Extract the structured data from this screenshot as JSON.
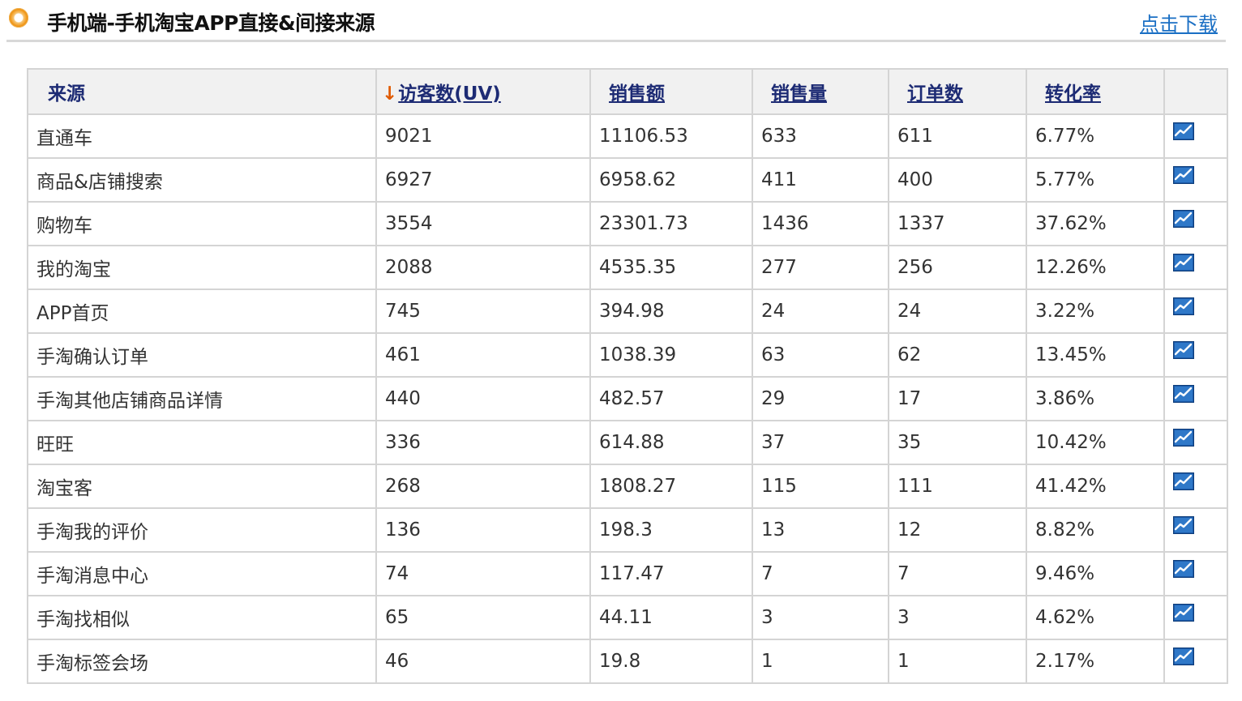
{
  "header": {
    "title": "手机端-手机淘宝APP直接&间接来源",
    "download_label": "点击下载"
  },
  "table": {
    "columns": [
      "来源",
      "访客数(UV)",
      "销售额",
      "销售量",
      "订单数",
      "转化率",
      ""
    ],
    "sort_arrow": "↓",
    "rows": [
      [
        "直通车",
        "9021",
        "11106.53",
        "633",
        "611",
        "6.77%"
      ],
      [
        "商品&店铺搜索",
        "6927",
        "6958.62",
        "411",
        "400",
        "5.77%"
      ],
      [
        "购物车",
        "3554",
        "23301.73",
        "1436",
        "1337",
        "37.62%"
      ],
      [
        "我的淘宝",
        "2088",
        "4535.35",
        "277",
        "256",
        "12.26%"
      ],
      [
        "APP首页",
        "745",
        "394.98",
        "24",
        "24",
        "3.22%"
      ],
      [
        "手淘确认订单",
        "461",
        "1038.39",
        "63",
        "62",
        "13.45%"
      ],
      [
        "手淘其他店铺商品详情",
        "440",
        "482.57",
        "29",
        "17",
        "3.86%"
      ],
      [
        "旺旺",
        "336",
        "614.88",
        "37",
        "35",
        "10.42%"
      ],
      [
        "淘宝客",
        "268",
        "1808.27",
        "115",
        "111",
        "41.42%"
      ],
      [
        "手淘我的评价",
        "136",
        "198.3",
        "13",
        "12",
        "8.82%"
      ],
      [
        "手淘消息中心",
        "74",
        "117.47",
        "7",
        "7",
        "9.46%"
      ],
      [
        "手淘找相似",
        "65",
        "44.11",
        "3",
        "3",
        "4.62%"
      ],
      [
        "手淘标签会场",
        "46",
        "19.8",
        "1",
        "1",
        "2.17%"
      ]
    ],
    "row_icon": "trend-chart-icon"
  },
  "colors": {
    "header_text": "#1d2b74",
    "link": "#1a6fc4",
    "sort_arrow": "#e05a00",
    "border": "#d4d4d4",
    "header_bg": "#f1f1f1"
  }
}
